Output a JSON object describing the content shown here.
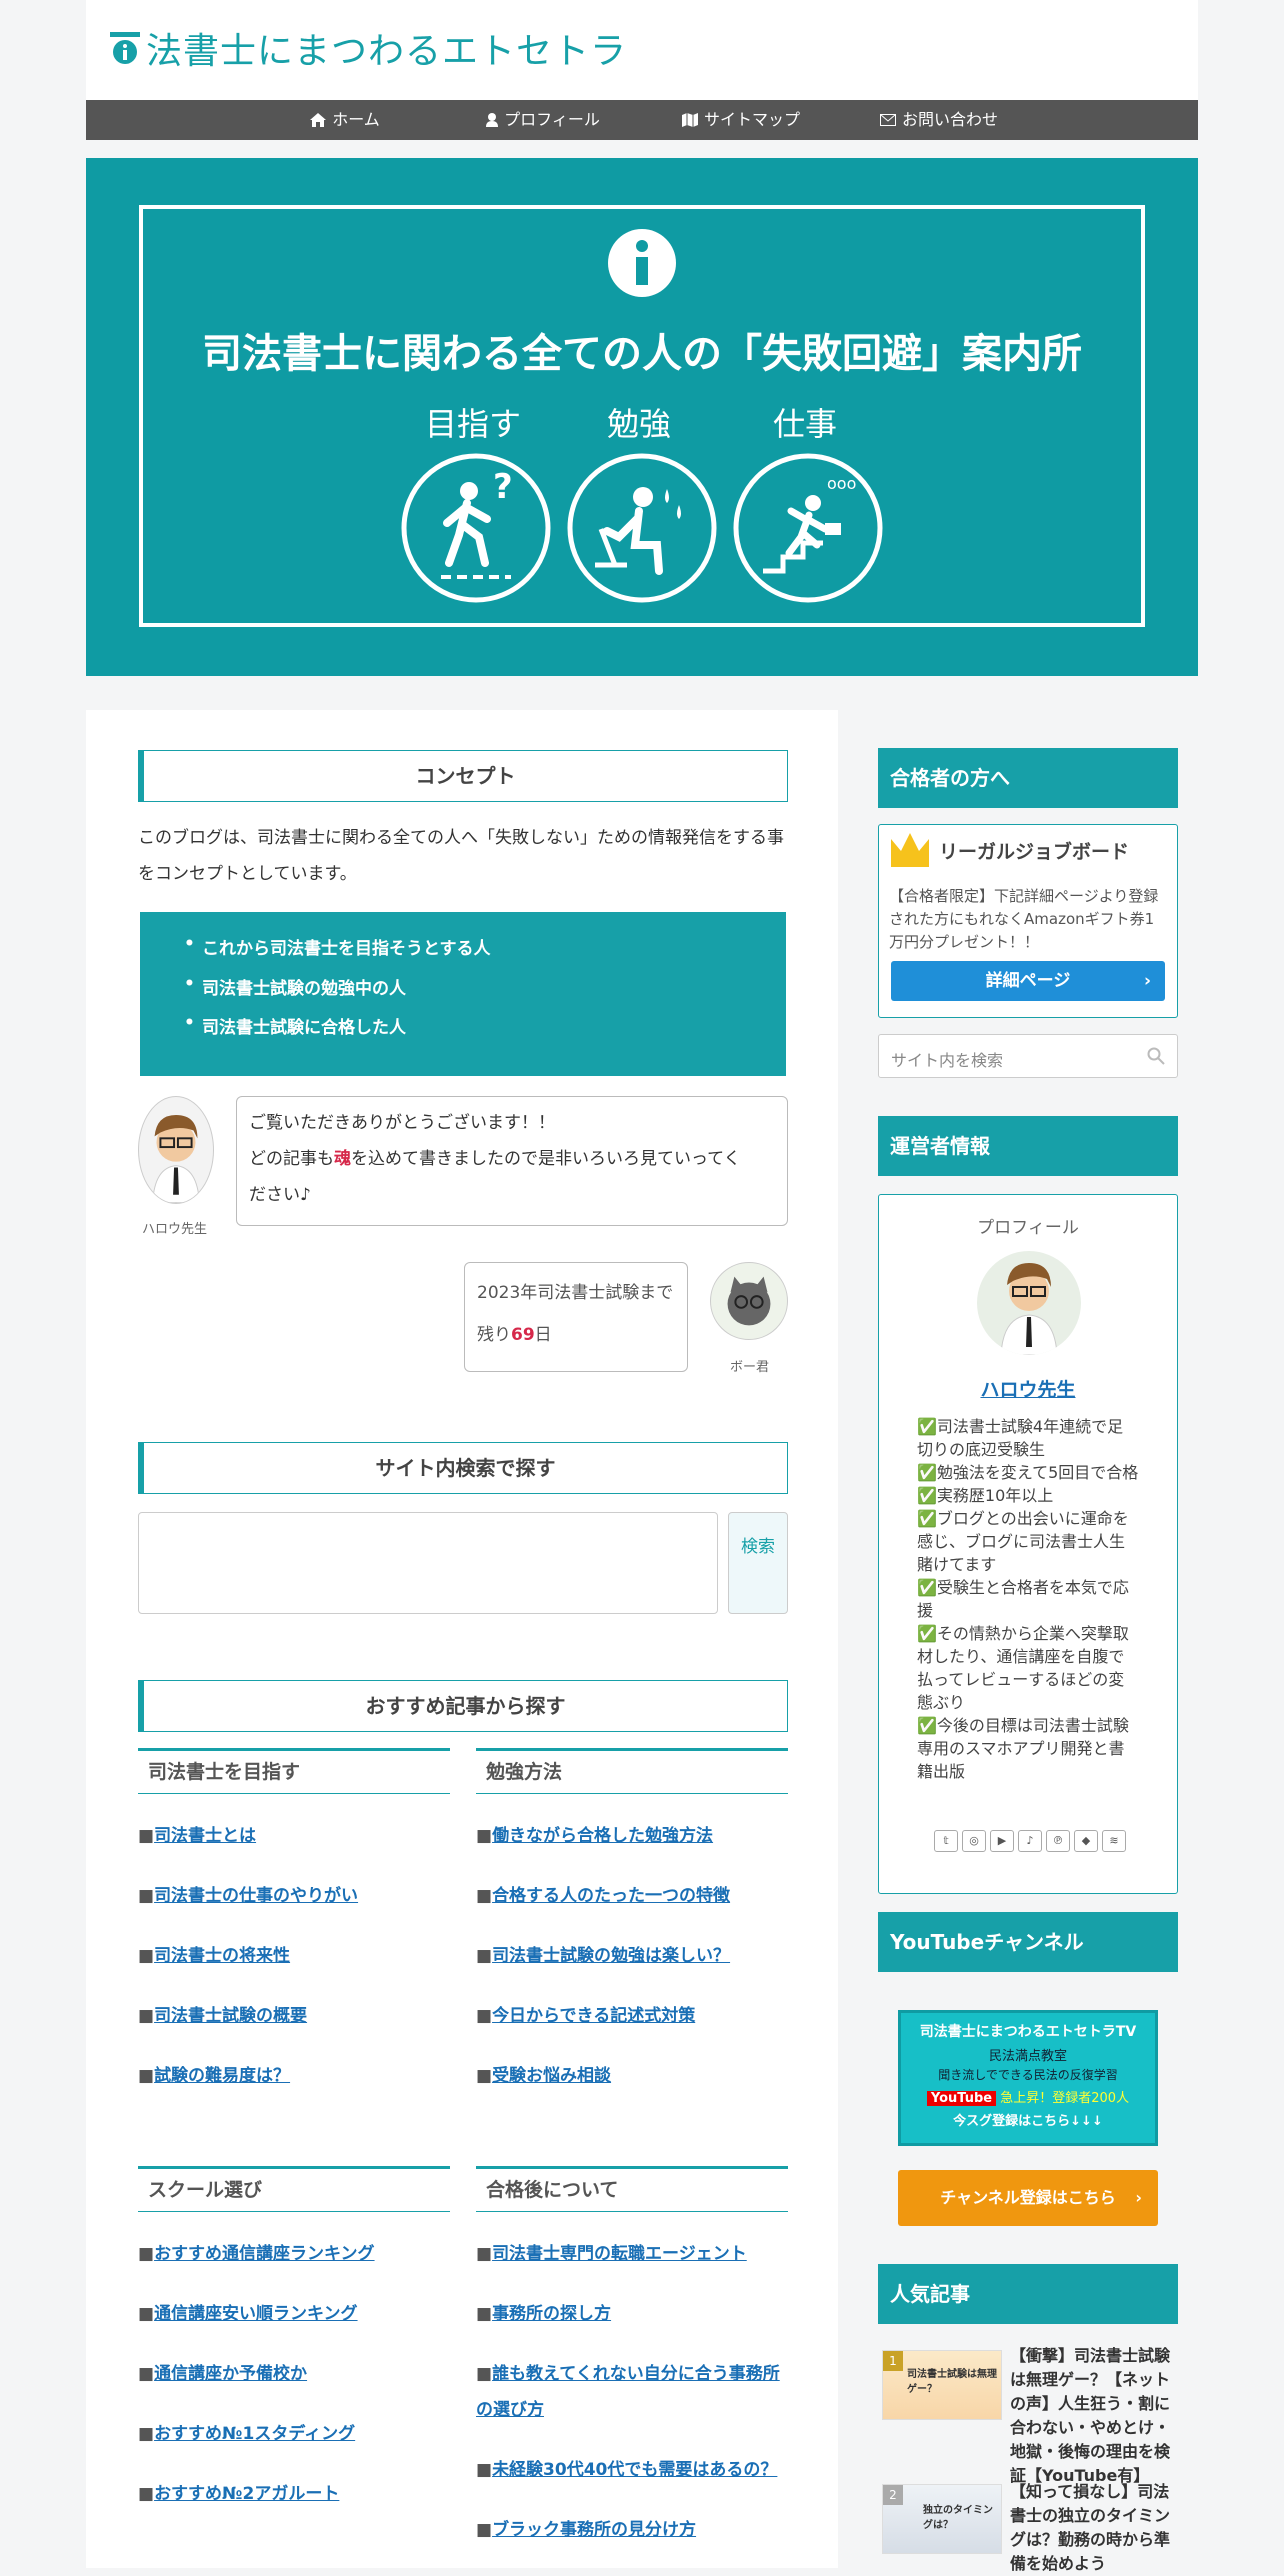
{
  "site": {
    "title": "法書士にまつわるエトセトラ"
  },
  "nav": [
    {
      "label": "ホーム",
      "icon": "home-icon"
    },
    {
      "label": "プロフィール",
      "icon": "user-icon"
    },
    {
      "label": "サイトマップ",
      "icon": "map-icon"
    },
    {
      "label": "お問い合わせ",
      "icon": "mail-icon"
    }
  ],
  "hero": {
    "title": "司法書士に関わる全ての人の「失敗回避」案内所",
    "labels": [
      "目指す",
      "勉強",
      "仕事"
    ]
  },
  "concept": {
    "heading": "コンセプト",
    "text": "このブログは、司法書士に関わる全ての人へ「失敗しない」ための情報発信をする事をコンセプトとしています。",
    "items": [
      "これから司法書士を目指そうとする人",
      "司法書士試験の勉強中の人",
      "司法書士試験に合格した人"
    ]
  },
  "chat1": {
    "name": "ハロウ先生",
    "line1": "ご覧いただきありがとうございます！！",
    "line2_a": "どの記事も",
    "line2_b": "魂",
    "line2_c": "を込めて書きましたので是非いろいろ見ていってく",
    "line3": "ださい♪"
  },
  "chat2": {
    "name": "ボー君",
    "line1": "2023年司法書士試験まで",
    "line2_a": "残り",
    "line2_b": "69",
    "line2_c": "日"
  },
  "search": {
    "heading": "サイト内検索で探す",
    "button": "検索"
  },
  "recommend": {
    "heading": "おすすめ記事から探す",
    "cols": [
      {
        "title": "司法書士を目指す",
        "links": [
          "司法書士とは",
          "司法書士の仕事のやりがい",
          "司法書士の将来性",
          "司法書士試験の概要",
          "試験の難易度は？"
        ]
      },
      {
        "title": "勉強方法",
        "links": [
          "働きながら合格した勉強方法",
          "合格する人のたった一つの特徴",
          "司法書士試験の勉強は楽しい？",
          "今日からできる記述式対策",
          "受験お悩み相談"
        ]
      },
      {
        "title": "スクール選び",
        "links": [
          "おすすめ通信講座ランキング",
          "通信講座安い順ランキング",
          "通信講座か予備校か",
          "おすすめ№1スタディング",
          "おすすめ№2アガルート"
        ]
      },
      {
        "title": "合格後について",
        "links": [
          "司法書士専門の転職エージェント",
          "事務所の探し方",
          "誰も教えてくれない自分に合う事務所の選び方",
          "未経験30代40代でも需要はあるの？",
          "ブラック事務所の見分け方"
        ]
      }
    ]
  },
  "sidebar": {
    "pass": {
      "heading": "合格者の方へ",
      "title": "リーガルジョブボード",
      "text": "【合格者限定】下記詳細ページより登録された方にもれなくAmazonギフト券1万円分プレゼント！！",
      "button": "詳細ページ"
    },
    "search_placeholder": "サイト内を検索",
    "operator": {
      "heading": "運営者情報",
      "label": "プロフィール",
      "name": "ハロウ先生",
      "bio": [
        "✅司法書士試験4年連続で足切りの底辺受験生",
        "✅勉強法を変えて5回目で合格",
        "✅実務歴10年以上",
        "✅ブログとの出会いに運命を感じ、ブログに司法書士人生賭けてます",
        "✅受験生と合格者を本気で応援",
        "✅その情熱から企業へ突撃取材したり、通信講座を自腹で払ってレビューするほどの変態ぶり",
        "✅今後の目標は司法書士試験専用のスマホアプリ開発と書籍出版"
      ]
    },
    "youtube": {
      "heading": "YouTubeチャンネル",
      "banner_title": "司法書士にまつわるエトセトラTV",
      "banner_sub1": "民法満点教室",
      "banner_sub2": "聞き流しでできる民法の反復学習",
      "banner_yt": "YouTube",
      "banner_count": "急上昇！登録者200人",
      "banner_cta": "今スグ登録はこちら↓↓↓",
      "button": "チャンネル登録はこちら"
    },
    "popular": {
      "heading": "人気記事",
      "items": [
        {
          "rank": "1",
          "thumb": "司法書士試験は無理ゲー？",
          "title": "【衝撃】司法書士試験は無理ゲー？【ネットの声】人生狂う・割に合わない・やめとけ・地獄・後悔の理由を検証【YouTube有】"
        },
        {
          "rank": "2",
          "thumb": "独立のタイミングは？",
          "title": "【知って損なし】司法書士の独立のタイミングは？勤務の時から準備を始めよう"
        }
      ]
    }
  },
  "colors": {
    "teal": "#17a0a8",
    "hero": "#0f9ba3",
    "nav": "#555555",
    "orange": "#f0970f",
    "blue": "#1f8fd8",
    "red": "#d6284a"
  }
}
